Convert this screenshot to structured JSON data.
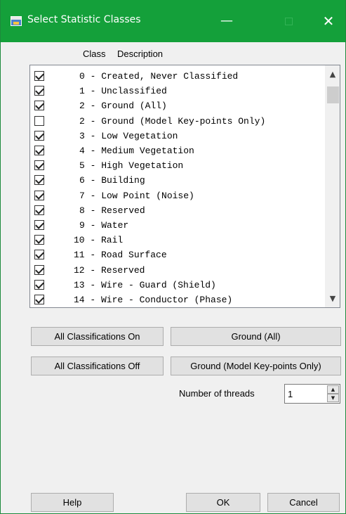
{
  "window": {
    "title": "Select Statistic Classes",
    "minimize_glyph": "—",
    "close_glyph": "✕",
    "title_color": "#14a03a"
  },
  "list": {
    "header_class": "Class",
    "header_description": "Description",
    "rows": [
      {
        "text": "0 - Created, Never Classified",
        "checked": true
      },
      {
        "text": "1 - Unclassified",
        "checked": true
      },
      {
        "text": "2 - Ground (All)",
        "checked": true
      },
      {
        "text": "2 - Ground (Model Key-points Only)",
        "checked": false
      },
      {
        "text": "3 - Low Vegetation",
        "checked": true
      },
      {
        "text": "4 - Medium Vegetation",
        "checked": true
      },
      {
        "text": "5 - High Vegetation",
        "checked": true
      },
      {
        "text": "6 - Building",
        "checked": true
      },
      {
        "text": "7 - Low Point (Noise)",
        "checked": true
      },
      {
        "text": "8 - Reserved",
        "checked": true
      },
      {
        "text": "9 - Water",
        "checked": true
      },
      {
        "text": "10 - Rail",
        "checked": true
      },
      {
        "text": "11 - Road Surface",
        "checked": true
      },
      {
        "text": "12 - Reserved",
        "checked": true
      },
      {
        "text": "13 - Wire - Guard (Shield)",
        "checked": true
      },
      {
        "text": "14 - Wire - Conductor (Phase)",
        "checked": true
      }
    ],
    "scroll_up_glyph": "▲",
    "scroll_down_glyph": "▼"
  },
  "buttons": {
    "all_on": "All Classifications On",
    "all_off": "All Classifications Off",
    "ground_all": "Ground (All)",
    "ground_model": "Ground (Model Key-points Only)",
    "help": "Help",
    "ok": "OK",
    "cancel": "Cancel"
  },
  "threads": {
    "label": "Number of threads",
    "value": "1",
    "up_glyph": "▲",
    "down_glyph": "▼"
  }
}
